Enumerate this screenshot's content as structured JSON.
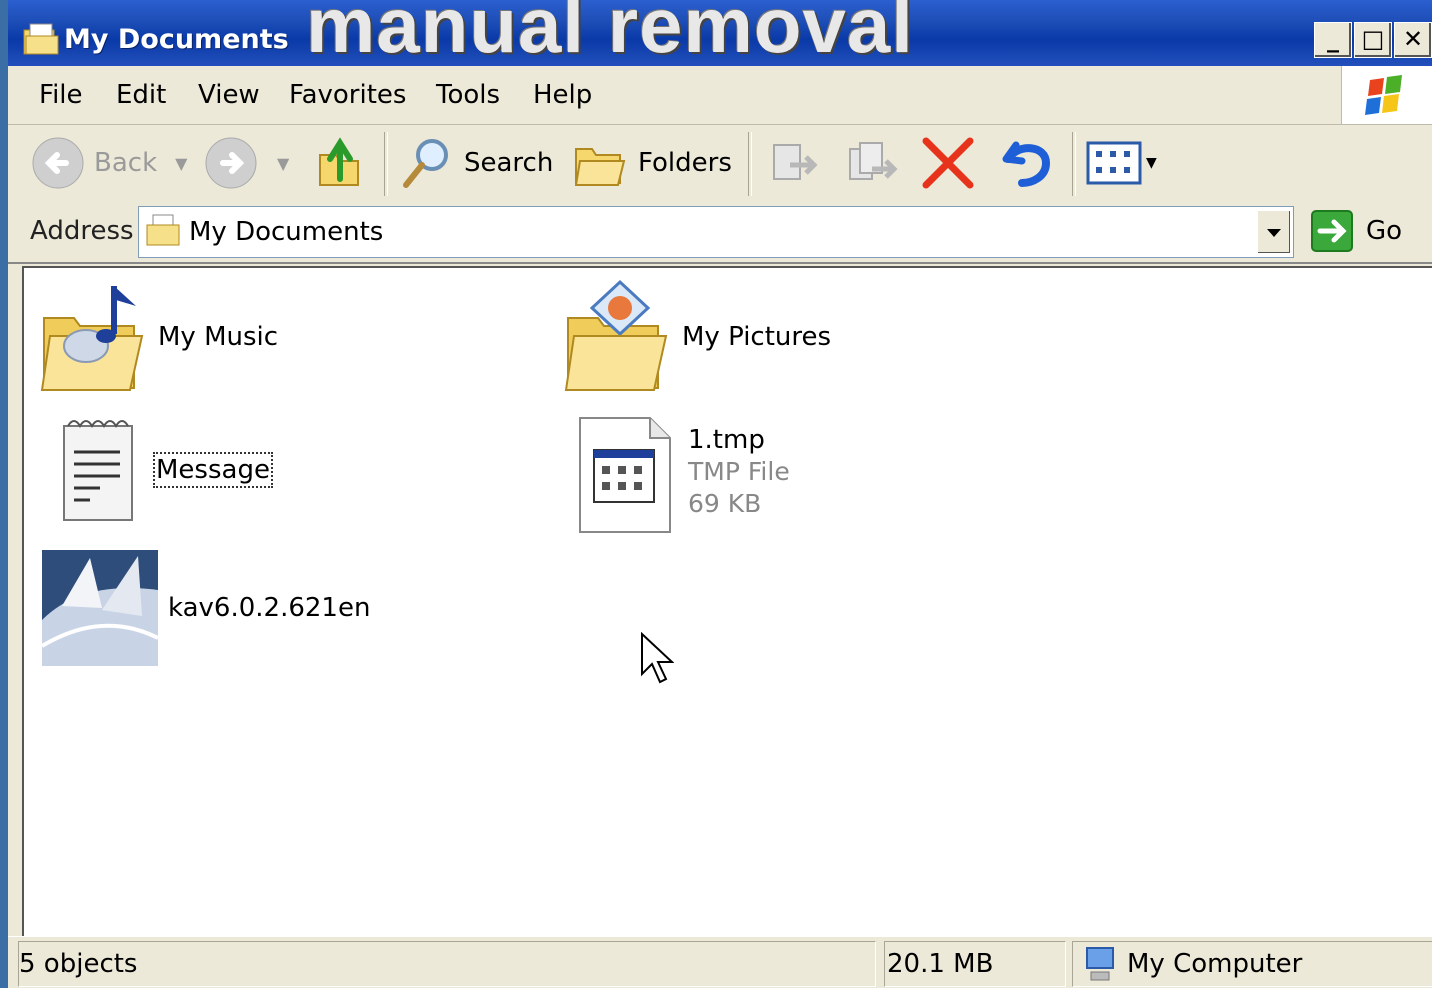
{
  "overlay": {
    "caption": "manual removal"
  },
  "window": {
    "title": "My Documents",
    "controls": {
      "minimize": "_",
      "maximize": "□",
      "close": "✕"
    }
  },
  "menu": {
    "items": [
      "File",
      "Edit",
      "View",
      "Favorites",
      "Tools",
      "Help"
    ]
  },
  "toolbar": {
    "back_label": "Back",
    "search_label": "Search",
    "folders_label": "Folders"
  },
  "address": {
    "label": "Address",
    "value": "My Documents",
    "go_label": "Go"
  },
  "files": [
    {
      "name": "My Music",
      "icon": "music-folder-icon"
    },
    {
      "name": "My Pictures",
      "icon": "pictures-folder-icon"
    },
    {
      "name": "Message",
      "icon": "notepad-icon",
      "selected_focus": true
    },
    {
      "name": "1.tmp",
      "type": "TMP File",
      "size": "69 KB",
      "icon": "tmp-file-icon"
    },
    {
      "name": "kav6.0.2.621en",
      "icon": "installer-icon"
    }
  ],
  "status": {
    "objects": "5 objects",
    "size": "20.1 MB",
    "zone": "My Computer"
  },
  "colors": {
    "titlebar": "#0a3aa8",
    "chrome": "#ece9d8",
    "delete_red": "#e8331c",
    "undo_blue": "#1e5fd8"
  }
}
